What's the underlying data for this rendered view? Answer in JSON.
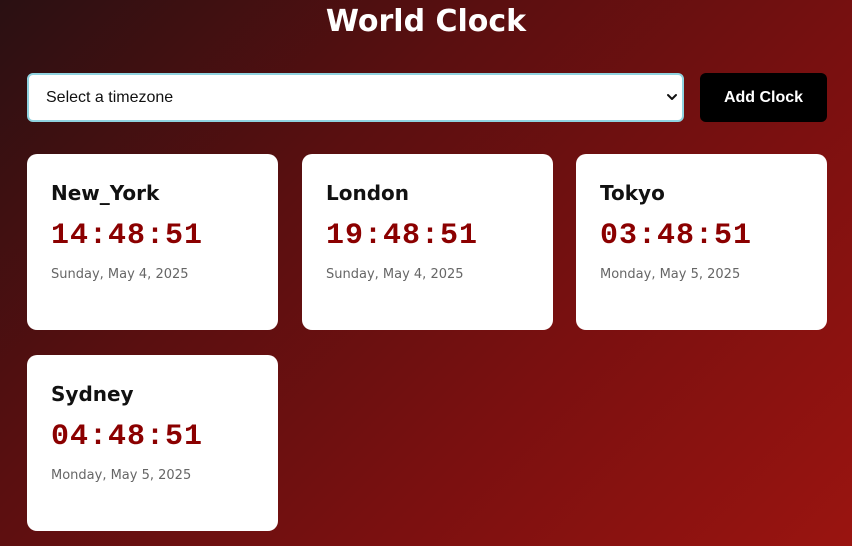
{
  "page": {
    "title": "World Clock"
  },
  "controls": {
    "select_value": "Select a timezone",
    "add_button_label": "Add Clock"
  },
  "clocks": [
    {
      "city": "New_York",
      "time": "14:48:51",
      "date": "Sunday, May 4, 2025"
    },
    {
      "city": "London",
      "time": "19:48:51",
      "date": "Sunday, May 4, 2025"
    },
    {
      "city": "Tokyo",
      "time": "03:48:51",
      "date": "Monday, May 5, 2025"
    },
    {
      "city": "Sydney",
      "time": "04:48:51",
      "date": "Monday, May 5, 2025"
    }
  ],
  "colors": {
    "time_text": "#8b0000",
    "button_bg": "#000000",
    "select_border": "#8fd3e0",
    "background_start": "#2a1012",
    "background_end": "#9a1410"
  },
  "icons": {
    "select_chevron": "chevron-down-icon"
  }
}
